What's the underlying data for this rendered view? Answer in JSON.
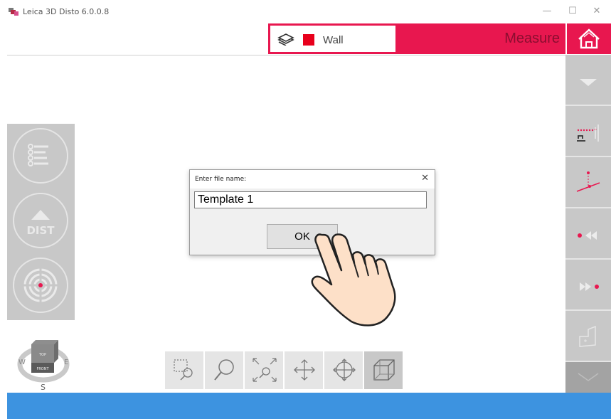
{
  "window": {
    "title": "Leica 3D Disto 6.0.0.8",
    "minimize_glyph": "—",
    "maximize_glyph": "☐",
    "close_glyph": "✕"
  },
  "toolbar": {
    "layer_icon": "layers-icon",
    "layer_color": "#e8001c",
    "layer_name": "Wall",
    "mode_label": "Measure",
    "home_icon": "home-icon",
    "accent_color": "#e8174f"
  },
  "left_panel": {
    "buttons": [
      {
        "icon": "list-icon"
      },
      {
        "icon": "dist-icon",
        "label": "DIST"
      },
      {
        "icon": "target-icon"
      }
    ]
  },
  "right_panel": {
    "buttons": [
      {
        "icon": "chevron-down-icon"
      },
      {
        "icon": "height-tracer-icon"
      },
      {
        "icon": "line-measure-icon"
      },
      {
        "icon": "rewind-icon"
      },
      {
        "icon": "fast-forward-icon"
      },
      {
        "icon": "floor-plan-icon"
      },
      {
        "icon": "chevron-down-outline-icon"
      }
    ]
  },
  "compass": {
    "cube_top": "TOP",
    "cube_front": "FRONT",
    "west": "W",
    "east": "E",
    "south": "S"
  },
  "view_tools": [
    {
      "icon": "zoom-window-icon"
    },
    {
      "icon": "zoom-icon"
    },
    {
      "icon": "zoom-extents-icon"
    },
    {
      "icon": "pan-icon"
    },
    {
      "icon": "orbit-icon"
    },
    {
      "icon": "3d-box-icon"
    }
  ],
  "dialog": {
    "title": "Enter file name:",
    "close_glyph": "✕",
    "input_value": "Template 1",
    "ok_label": "OK"
  },
  "statusbar": {
    "color": "#3d93e0"
  }
}
